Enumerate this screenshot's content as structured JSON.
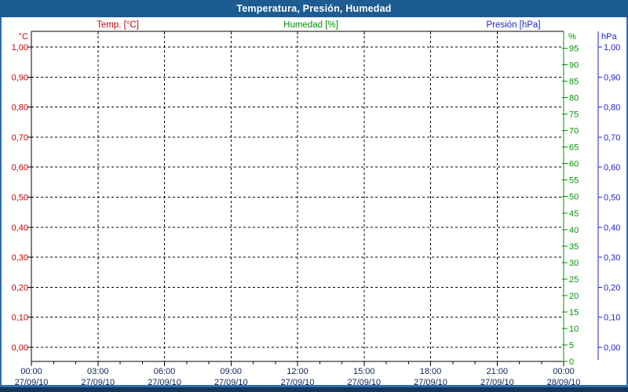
{
  "window": {
    "title": "Temperatura, Presión, Humedad"
  },
  "legend": [
    {
      "label": "Temp. [°C]",
      "color": "#cc0000"
    },
    {
      "label": "Humedad [%]",
      "color": "#009400"
    },
    {
      "label": "Presión [hPa]",
      "color": "#2222cc"
    }
  ],
  "axes": {
    "temp": {
      "unit": "°C",
      "color": "#cc0000",
      "tick_labels": [
        "1,00",
        "0,90",
        "0,80",
        "0,70",
        "0,60",
        "0,50",
        "0,40",
        "0,30",
        "0,20",
        "0,10",
        "0,00"
      ]
    },
    "humidity": {
      "unit": "%",
      "color": "#009400",
      "tick_labels": [
        "95",
        "90",
        "85",
        "80",
        "75",
        "70",
        "65",
        "60",
        "55",
        "50",
        "45",
        "40",
        "35",
        "30",
        "25",
        "20",
        "15",
        "10",
        "5",
        "0"
      ]
    },
    "pressure": {
      "unit": "hPa",
      "color": "#2222cc",
      "tick_labels": [
        "1,00",
        "0,90",
        "0,80",
        "0,70",
        "0,60",
        "0,50",
        "0,40",
        "0,30",
        "0,20",
        "0,10",
        "0,00"
      ]
    },
    "x": {
      "color": "#0c2052",
      "ticks": [
        {
          "time": "00:00",
          "date": "27/09/10"
        },
        {
          "time": "03:00",
          "date": "27/09/10"
        },
        {
          "time": "06:00",
          "date": "27/09/10"
        },
        {
          "time": "09:00",
          "date": "27/09/10"
        },
        {
          "time": "12:00",
          "date": "27/09/10"
        },
        {
          "time": "15:00",
          "date": "27/09/10"
        },
        {
          "time": "18:00",
          "date": "27/09/10"
        },
        {
          "time": "21:00",
          "date": "27/09/10"
        },
        {
          "time": "00:00",
          "date": "28/09/10"
        }
      ]
    }
  },
  "chart_data": {
    "type": "line",
    "title": "Temperatura, Presión, Humedad",
    "x_ticks": [
      "27/09/10 00:00",
      "27/09/10 03:00",
      "27/09/10 06:00",
      "27/09/10 09:00",
      "27/09/10 12:00",
      "27/09/10 15:00",
      "27/09/10 18:00",
      "27/09/10 21:00",
      "28/09/10 00:00"
    ],
    "grid": true,
    "legend_position": "top",
    "series": [
      {
        "name": "Temp. [°C]",
        "axis": "left",
        "ylim": [
          0,
          1
        ],
        "y_tick_step": 0.1,
        "color": "#cc0000",
        "values": []
      },
      {
        "name": "Humedad [%]",
        "axis": "right",
        "ylim": [
          0,
          100
        ],
        "y_tick_step": 5,
        "color": "#009400",
        "values": []
      },
      {
        "name": "Presión [hPa]",
        "axis": "right-outer",
        "ylim": [
          0,
          1
        ],
        "y_tick_step": 0.1,
        "color": "#2222cc",
        "values": []
      }
    ]
  },
  "colors": {
    "title_bar": "#1d5b93",
    "frame": "#2e6fae",
    "bottom_band": "#16355b",
    "grid": "#000000",
    "plot_background": "#ffffff"
  }
}
